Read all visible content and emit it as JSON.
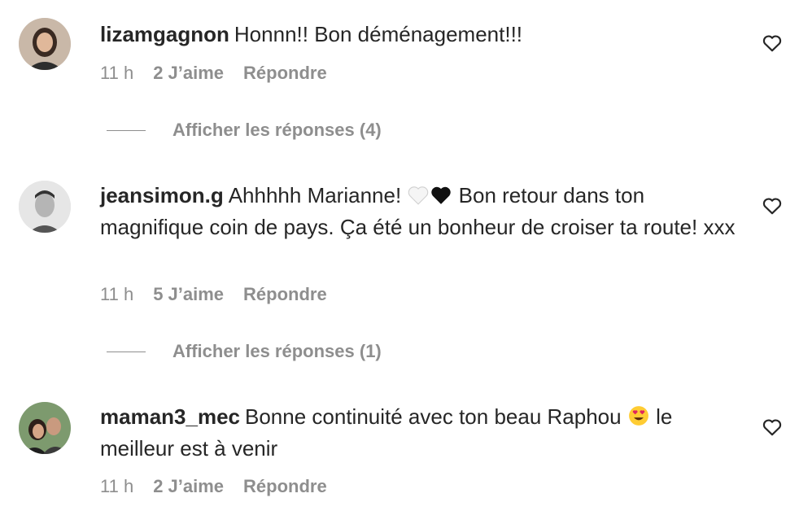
{
  "comments": [
    {
      "username": "lizamgagnon",
      "text": "Honnn!! Bon déménagement!!!",
      "time": "11 h",
      "likes": "2 J’aime",
      "reply": "Répondre",
      "view_replies": "Afficher les réponses (4)"
    },
    {
      "username": "jeansimon.g",
      "text_before": "Ahhhhh Marianne!",
      "emojis": [
        "white-heart",
        "black-heart"
      ],
      "text_after": "Bon retour dans ton magnifique coin de pays. Ça été un bonheur de croiser ta route! xxx",
      "time": "11 h",
      "likes": "5 J’aime",
      "reply": "Répondre",
      "view_replies": "Afficher les réponses (1)"
    },
    {
      "username": "maman3_mec",
      "text_before": "Bonne continuité avec ton beau Raphou",
      "emojis": [
        "heart-eyes"
      ],
      "text_after": "le meilleur est à venir",
      "time": "11 h",
      "likes": "2 J’aime",
      "reply": "Répondre"
    }
  ],
  "colors": {
    "text": "#262626",
    "secondary": "#8e8e8e",
    "background": "#ffffff"
  }
}
